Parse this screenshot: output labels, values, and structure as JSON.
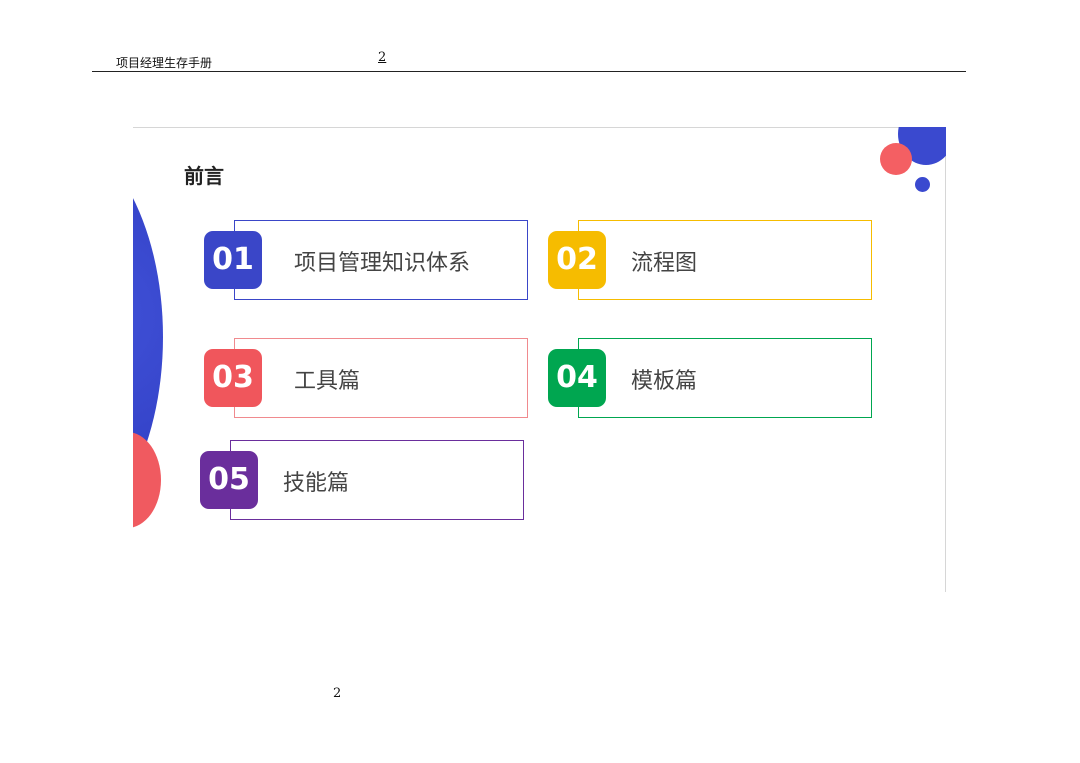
{
  "header": {
    "title": "项目经理生存手册",
    "page_number": "2"
  },
  "footer": {
    "page_number": "2"
  },
  "slide": {
    "heading": "前言",
    "items": [
      {
        "number": "01",
        "label": "项目管理知识体系",
        "color": "#3a46c8"
      },
      {
        "number": "02",
        "label": "流程图",
        "color": "#f6bc00"
      },
      {
        "number": "03",
        "label": "工具篇",
        "color": "#f0565c"
      },
      {
        "number": "04",
        "label": "模板篇",
        "color": "#00a650"
      },
      {
        "number": "05",
        "label": "技能篇",
        "color": "#6a2e9c"
      }
    ]
  }
}
